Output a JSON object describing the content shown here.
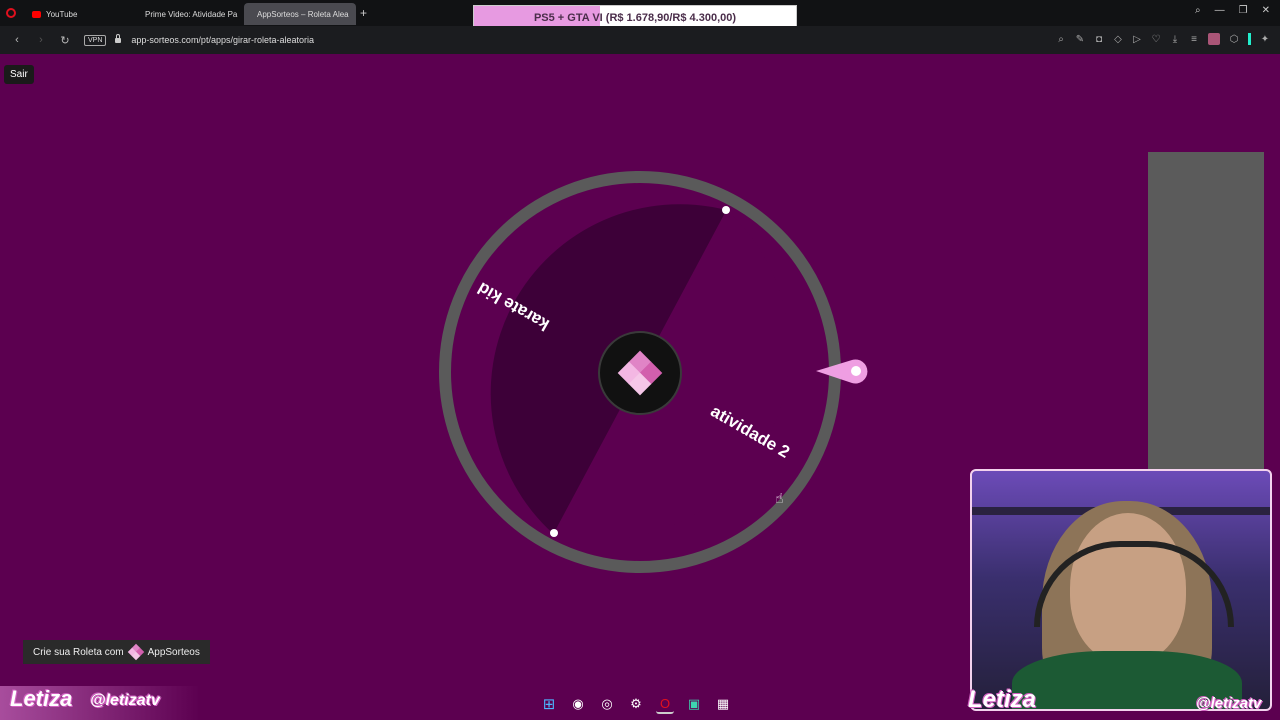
{
  "browser": {
    "tabs": [
      {
        "title": "YouTube",
        "icon": "youtube-icon"
      },
      {
        "title": "Prime Video: Atividade Pa",
        "icon": "prime-video-icon"
      },
      {
        "title": "AppSorteos – Roleta Alea",
        "icon": "appsorteos-icon",
        "active": true
      }
    ],
    "url": "app-sorteos.com/pt/apps/girar-roleta-aleatoria",
    "vpn_label": "VPN"
  },
  "promo": {
    "text": "PS5 + GTA VI (R$ 1.678,90/R$ 4.300,00)",
    "progress_fraction": 0.39
  },
  "page": {
    "exit_label": "Sair",
    "wheel": {
      "segments": [
        {
          "label": "karate kid",
          "color": "#3d0038"
        },
        {
          "label": "atividade 2",
          "color": "#5c0050"
        }
      ],
      "rim_color": "#5a5a5a",
      "pointer_color": "#ef9ee2"
    },
    "badge": {
      "prefix": "Crie sua Roleta com",
      "brand": "AppSorteos"
    }
  },
  "stream": {
    "name_left": "Letiza",
    "handle_left": "@letizatv",
    "name_right": "Letiza",
    "handle_right": "@letizatv"
  },
  "taskbar": {
    "icons": [
      "windows-icon",
      "discord-icon",
      "obs-icon",
      "steam-icon",
      "opera-icon",
      "app-icon",
      "calculator-icon"
    ]
  }
}
